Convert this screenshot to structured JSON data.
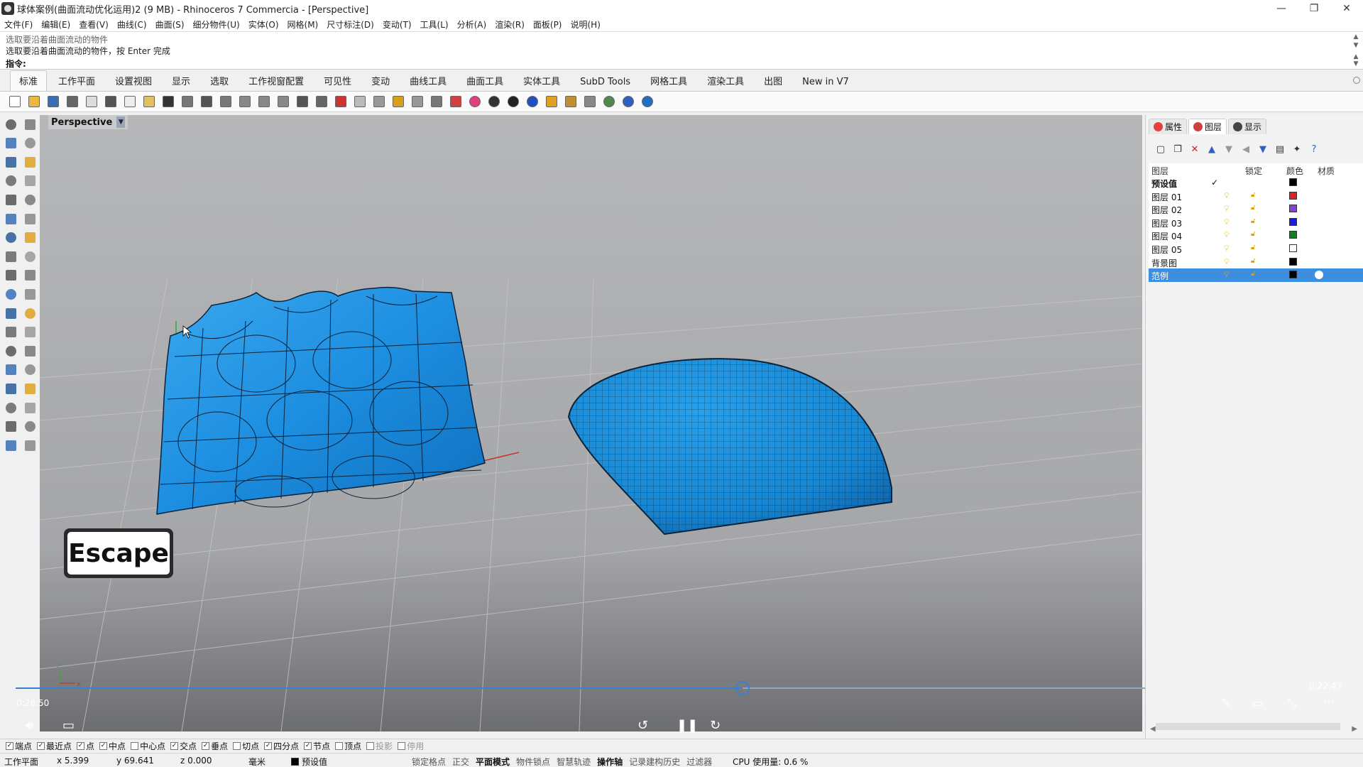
{
  "window": {
    "title": "球体案例(曲面流动优化运用)2 (9 MB) - Rhinoceros 7 Commercia - [Perspective]",
    "controls": [
      "—",
      "❐",
      "✕"
    ]
  },
  "menu": [
    "文件(F)",
    "编辑(E)",
    "查看(V)",
    "曲线(C)",
    "曲面(S)",
    "细分物件(U)",
    "实体(O)",
    "网格(M)",
    "尺寸标注(D)",
    "变动(T)",
    "工具(L)",
    "分析(A)",
    "渲染(R)",
    "面板(P)",
    "说明(H)"
  ],
  "command": {
    "history": [
      "选取要沿着曲面流动的物件",
      "选取要沿着曲面流动的物件，按 Enter 完成"
    ],
    "prompt": "指令:",
    "value": ""
  },
  "tabs": [
    "标准",
    "工作平面",
    "设置视图",
    "显示",
    "选取",
    "工作视窗配置",
    "可见性",
    "变动",
    "曲线工具",
    "曲面工具",
    "实体工具",
    "SubD Tools",
    "网格工具",
    "渲染工具",
    "出图",
    "New in V7"
  ],
  "active_tab": 0,
  "toolbar_icons": [
    {
      "name": "new-icon",
      "color": "#ffffff"
    },
    {
      "name": "open-icon",
      "color": "#e8b840"
    },
    {
      "name": "save-icon",
      "color": "#3a6db5"
    },
    {
      "name": "print-icon",
      "color": "#666666"
    },
    {
      "name": "import-icon",
      "color": "#dddddd"
    },
    {
      "name": "cut-icon",
      "color": "#555555"
    },
    {
      "name": "copy-icon",
      "color": "#eeeeee"
    },
    {
      "name": "paste-icon",
      "color": "#e0c060"
    },
    {
      "name": "undo-icon",
      "color": "#333333"
    },
    {
      "name": "pan-icon",
      "color": "#777777"
    },
    {
      "name": "move-view-icon",
      "color": "#555555"
    },
    {
      "name": "zoom-icon",
      "color": "#777777"
    },
    {
      "name": "zoom-window-icon",
      "color": "#888888"
    },
    {
      "name": "zoom-extents-icon",
      "color": "#888888"
    },
    {
      "name": "zoom-selected-icon",
      "color": "#888888"
    },
    {
      "name": "rotate-view-icon",
      "color": "#555555"
    },
    {
      "name": "four-views-icon",
      "color": "#666666"
    },
    {
      "name": "cplane-icon",
      "color": "#cc3333"
    },
    {
      "name": "named-view-icon",
      "color": "#bbbbbb"
    },
    {
      "name": "select-icon",
      "color": "#999999"
    },
    {
      "name": "points-icon",
      "color": "#d4a020"
    },
    {
      "name": "light-icon",
      "color": "#999999"
    },
    {
      "name": "lock-icon",
      "color": "#777777"
    },
    {
      "name": "layer-icon",
      "color": "#d04040"
    },
    {
      "name": "color-wheel-icon",
      "color": "#e04080"
    },
    {
      "name": "shaded-sphere-icon",
      "color": "#333333"
    },
    {
      "name": "rendered-sphere-icon",
      "color": "#222222"
    },
    {
      "name": "material-sphere-icon",
      "color": "#2050c0"
    },
    {
      "name": "filter-icon",
      "color": "#e0a020"
    },
    {
      "name": "options-icon",
      "color": "#c09030"
    },
    {
      "name": "grid-snap-icon",
      "color": "#888888"
    },
    {
      "name": "globe-icon",
      "color": "#508850"
    },
    {
      "name": "help-icon",
      "color": "#3060c0"
    },
    {
      "name": "update-icon",
      "color": "#2070c0"
    }
  ],
  "viewport": {
    "label": "Perspective",
    "badge": "Escape"
  },
  "player": {
    "elapsed": "0:28:50",
    "remaining": "0:22:47",
    "progress": 0.547
  },
  "right_panel": {
    "tabs": [
      {
        "label": "属性",
        "color": "#e04040"
      },
      {
        "label": "图层",
        "color": "#d04040"
      },
      {
        "label": "显示",
        "color": "#444444"
      }
    ],
    "active_tab": 1,
    "toolbar": [
      "new-layer-icon",
      "new-sublayer-icon",
      "delete-icon",
      "move-up-icon",
      "move-down-icon",
      "move-left-icon",
      "filter-icon",
      "layer-panel-icon",
      "tools-icon",
      "help-icon"
    ],
    "headers": {
      "name": "图层",
      "lock": "锁定",
      "color": "颜色",
      "material": "材质"
    },
    "layers": [
      {
        "name": "预设值",
        "current": true,
        "color": "#000000",
        "selected": false
      },
      {
        "name": "图层 01",
        "current": false,
        "color": "#e02020",
        "selected": false
      },
      {
        "name": "图层 02",
        "current": false,
        "color": "#8a40d8",
        "selected": false
      },
      {
        "name": "图层 03",
        "current": false,
        "color": "#1a1ae0",
        "selected": false
      },
      {
        "name": "图层 04",
        "current": false,
        "color": "#108020",
        "selected": false
      },
      {
        "name": "图层 05",
        "current": false,
        "color": "#ffffff",
        "selected": false
      },
      {
        "name": "背景图",
        "current": false,
        "color": "#000000",
        "selected": false
      },
      {
        "name": "范例",
        "current": false,
        "color": "#000000",
        "selected": true
      }
    ]
  },
  "snaps": [
    {
      "label": "端点",
      "on": true
    },
    {
      "label": "最近点",
      "on": true
    },
    {
      "label": "点",
      "on": true
    },
    {
      "label": "中点",
      "on": true
    },
    {
      "label": "中心点",
      "on": false
    },
    {
      "label": "交点",
      "on": true
    },
    {
      "label": "垂点",
      "on": true
    },
    {
      "label": "切点",
      "on": false
    },
    {
      "label": "四分点",
      "on": true
    },
    {
      "label": "节点",
      "on": true
    },
    {
      "label": "顶点",
      "on": false
    },
    {
      "label": "投影",
      "on": false
    },
    {
      "label": "停用",
      "on": false
    }
  ],
  "status": {
    "cplane": "工作平面",
    "x": "x 5.399",
    "y": "y 69.641",
    "z": "z 0.000",
    "unit": "毫米",
    "layer": "预设值",
    "modes": [
      "锁定格点",
      "正交",
      "平面模式",
      "物件锁点",
      "智慧轨迹",
      "操作轴",
      "记录建构历史",
      "过滤器"
    ],
    "cpu": "CPU 使用量: 0.6 %"
  }
}
